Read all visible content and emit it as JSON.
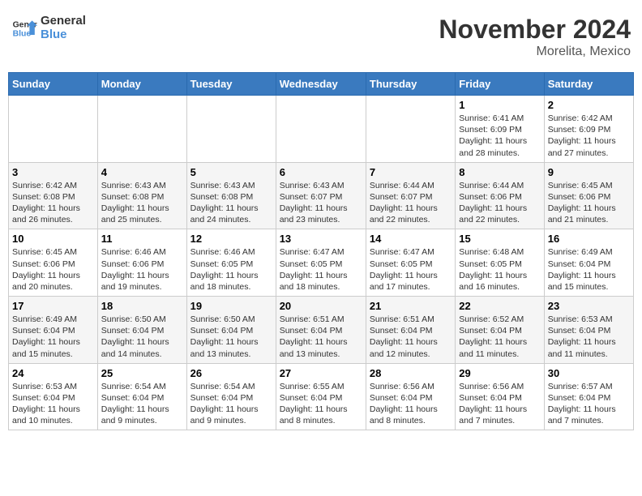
{
  "header": {
    "logo_line1": "General",
    "logo_line2": "Blue",
    "month_title": "November 2024",
    "location": "Morelita, Mexico"
  },
  "days_of_week": [
    "Sunday",
    "Monday",
    "Tuesday",
    "Wednesday",
    "Thursday",
    "Friday",
    "Saturday"
  ],
  "weeks": [
    [
      {
        "day": "",
        "info": ""
      },
      {
        "day": "",
        "info": ""
      },
      {
        "day": "",
        "info": ""
      },
      {
        "day": "",
        "info": ""
      },
      {
        "day": "",
        "info": ""
      },
      {
        "day": "1",
        "info": "Sunrise: 6:41 AM\nSunset: 6:09 PM\nDaylight: 11 hours and 28 minutes."
      },
      {
        "day": "2",
        "info": "Sunrise: 6:42 AM\nSunset: 6:09 PM\nDaylight: 11 hours and 27 minutes."
      }
    ],
    [
      {
        "day": "3",
        "info": "Sunrise: 6:42 AM\nSunset: 6:08 PM\nDaylight: 11 hours and 26 minutes."
      },
      {
        "day": "4",
        "info": "Sunrise: 6:43 AM\nSunset: 6:08 PM\nDaylight: 11 hours and 25 minutes."
      },
      {
        "day": "5",
        "info": "Sunrise: 6:43 AM\nSunset: 6:08 PM\nDaylight: 11 hours and 24 minutes."
      },
      {
        "day": "6",
        "info": "Sunrise: 6:43 AM\nSunset: 6:07 PM\nDaylight: 11 hours and 23 minutes."
      },
      {
        "day": "7",
        "info": "Sunrise: 6:44 AM\nSunset: 6:07 PM\nDaylight: 11 hours and 22 minutes."
      },
      {
        "day": "8",
        "info": "Sunrise: 6:44 AM\nSunset: 6:06 PM\nDaylight: 11 hours and 22 minutes."
      },
      {
        "day": "9",
        "info": "Sunrise: 6:45 AM\nSunset: 6:06 PM\nDaylight: 11 hours and 21 minutes."
      }
    ],
    [
      {
        "day": "10",
        "info": "Sunrise: 6:45 AM\nSunset: 6:06 PM\nDaylight: 11 hours and 20 minutes."
      },
      {
        "day": "11",
        "info": "Sunrise: 6:46 AM\nSunset: 6:06 PM\nDaylight: 11 hours and 19 minutes."
      },
      {
        "day": "12",
        "info": "Sunrise: 6:46 AM\nSunset: 6:05 PM\nDaylight: 11 hours and 18 minutes."
      },
      {
        "day": "13",
        "info": "Sunrise: 6:47 AM\nSunset: 6:05 PM\nDaylight: 11 hours and 18 minutes."
      },
      {
        "day": "14",
        "info": "Sunrise: 6:47 AM\nSunset: 6:05 PM\nDaylight: 11 hours and 17 minutes."
      },
      {
        "day": "15",
        "info": "Sunrise: 6:48 AM\nSunset: 6:05 PM\nDaylight: 11 hours and 16 minutes."
      },
      {
        "day": "16",
        "info": "Sunrise: 6:49 AM\nSunset: 6:04 PM\nDaylight: 11 hours and 15 minutes."
      }
    ],
    [
      {
        "day": "17",
        "info": "Sunrise: 6:49 AM\nSunset: 6:04 PM\nDaylight: 11 hours and 15 minutes."
      },
      {
        "day": "18",
        "info": "Sunrise: 6:50 AM\nSunset: 6:04 PM\nDaylight: 11 hours and 14 minutes."
      },
      {
        "day": "19",
        "info": "Sunrise: 6:50 AM\nSunset: 6:04 PM\nDaylight: 11 hours and 13 minutes."
      },
      {
        "day": "20",
        "info": "Sunrise: 6:51 AM\nSunset: 6:04 PM\nDaylight: 11 hours and 13 minutes."
      },
      {
        "day": "21",
        "info": "Sunrise: 6:51 AM\nSunset: 6:04 PM\nDaylight: 11 hours and 12 minutes."
      },
      {
        "day": "22",
        "info": "Sunrise: 6:52 AM\nSunset: 6:04 PM\nDaylight: 11 hours and 11 minutes."
      },
      {
        "day": "23",
        "info": "Sunrise: 6:53 AM\nSunset: 6:04 PM\nDaylight: 11 hours and 11 minutes."
      }
    ],
    [
      {
        "day": "24",
        "info": "Sunrise: 6:53 AM\nSunset: 6:04 PM\nDaylight: 11 hours and 10 minutes."
      },
      {
        "day": "25",
        "info": "Sunrise: 6:54 AM\nSunset: 6:04 PM\nDaylight: 11 hours and 9 minutes."
      },
      {
        "day": "26",
        "info": "Sunrise: 6:54 AM\nSunset: 6:04 PM\nDaylight: 11 hours and 9 minutes."
      },
      {
        "day": "27",
        "info": "Sunrise: 6:55 AM\nSunset: 6:04 PM\nDaylight: 11 hours and 8 minutes."
      },
      {
        "day": "28",
        "info": "Sunrise: 6:56 AM\nSunset: 6:04 PM\nDaylight: 11 hours and 8 minutes."
      },
      {
        "day": "29",
        "info": "Sunrise: 6:56 AM\nSunset: 6:04 PM\nDaylight: 11 hours and 7 minutes."
      },
      {
        "day": "30",
        "info": "Sunrise: 6:57 AM\nSunset: 6:04 PM\nDaylight: 11 hours and 7 minutes."
      }
    ]
  ]
}
